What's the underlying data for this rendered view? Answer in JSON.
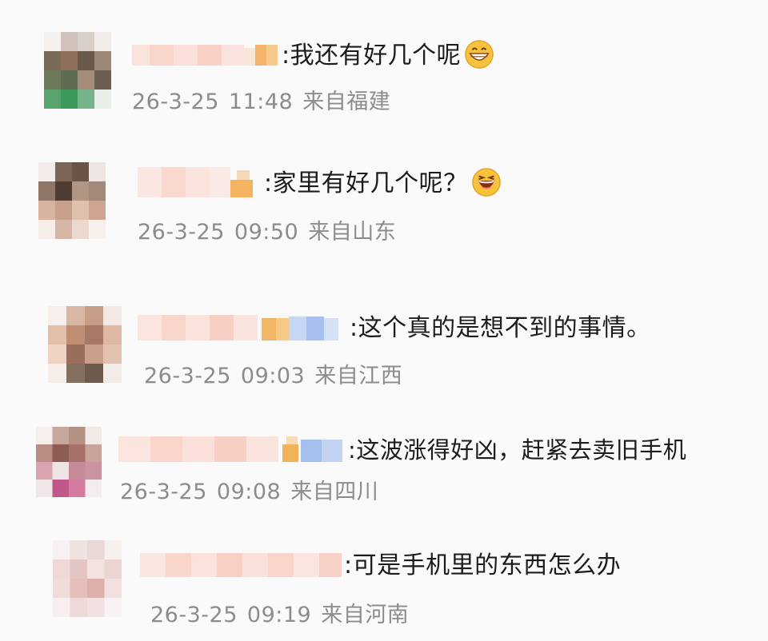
{
  "comments": [
    {
      "text": ":我还有好几个呢",
      "emoji": "grinning-face-icon",
      "date": "26-3-25",
      "time": "11:48",
      "location": "来自福建"
    },
    {
      "text": ":家里有好几个呢？",
      "emoji": "laughing-face-icon",
      "date": "26-3-25",
      "time": "09:50",
      "location": "来自山东"
    },
    {
      "text": ":这个真的是想不到的事情。",
      "date": "26-3-25",
      "time": "09:03",
      "location": "来自江西"
    },
    {
      "text": ":这波涨得好凶，赶紧去卖旧手机",
      "date": "26-3-25",
      "time": "09:08",
      "location": "来自四川"
    },
    {
      "text": ":可是手机里的东西怎么办",
      "date": "26-3-25",
      "time": "09:19",
      "location": "来自河南"
    }
  ],
  "colors": {
    "text": "#1c1c1c",
    "meta": "#8c8c8c",
    "background": "#fafafa"
  }
}
